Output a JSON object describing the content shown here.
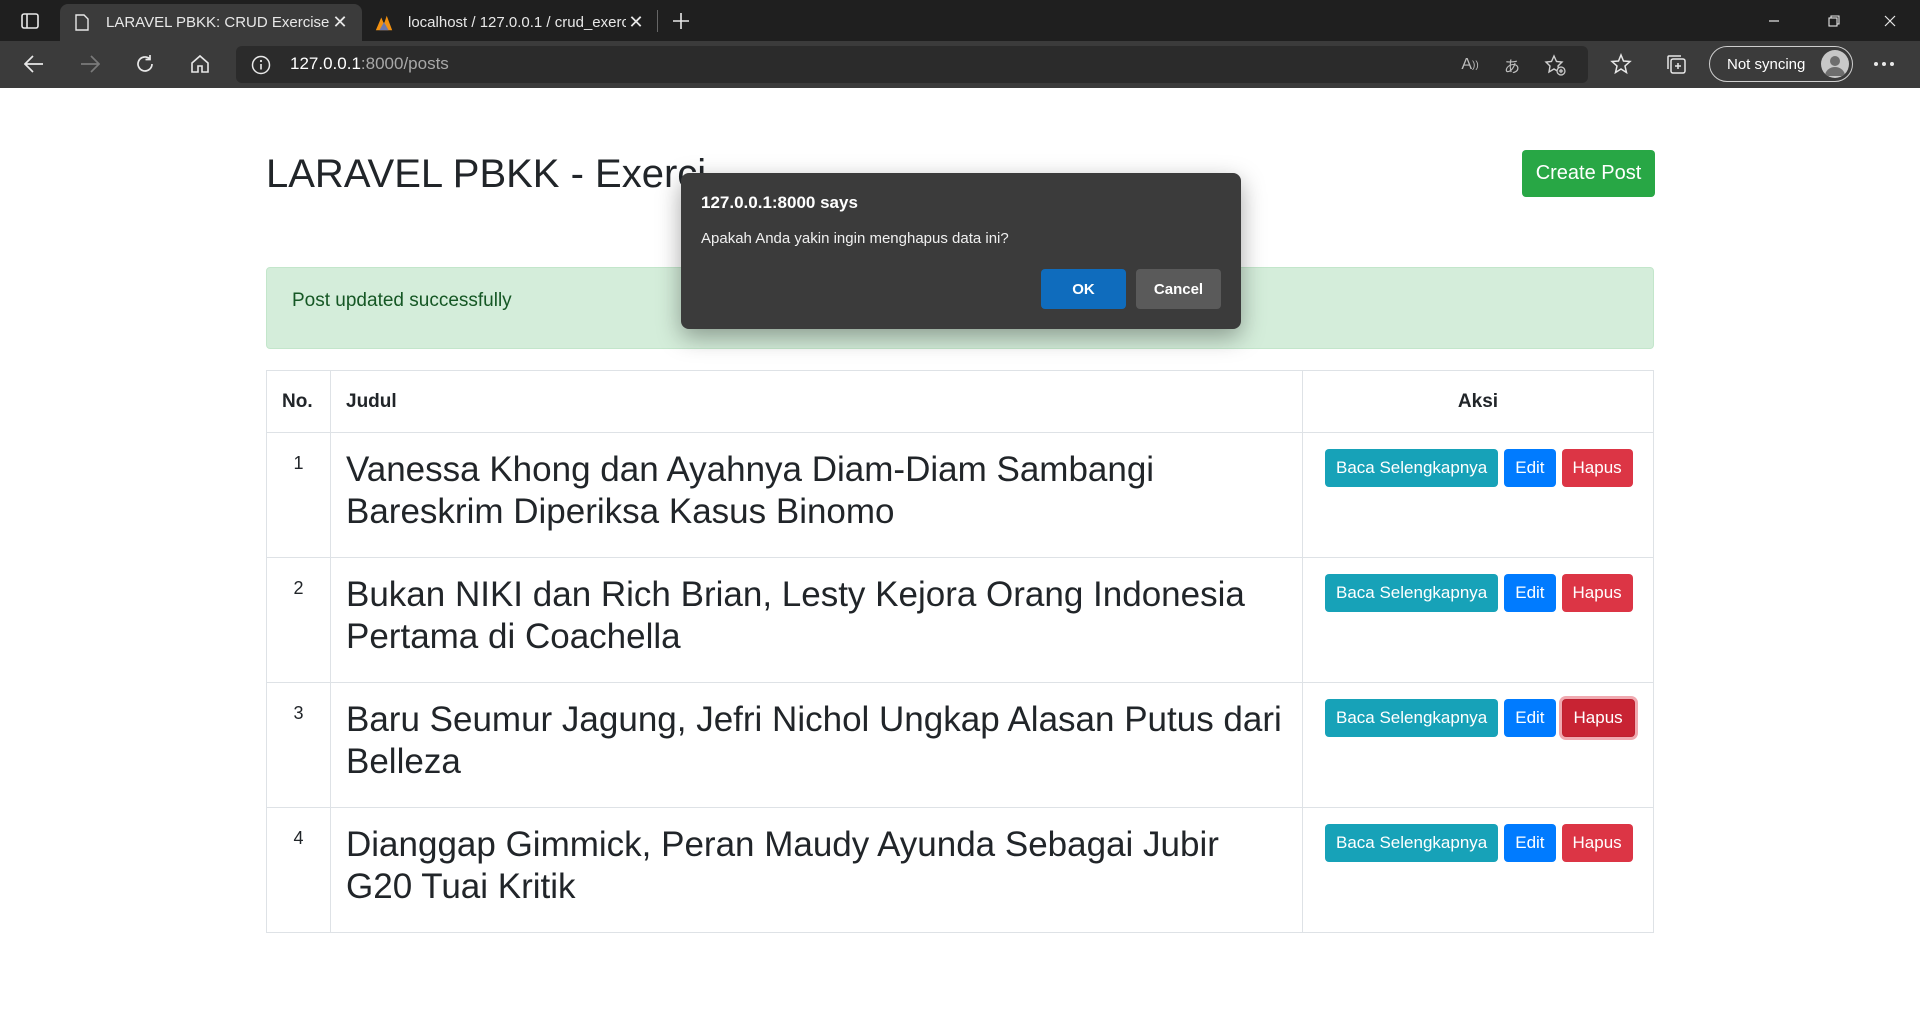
{
  "browser": {
    "tabs": [
      {
        "title": "LARAVEL PBKK: CRUD Exercise",
        "active": true
      },
      {
        "title": "localhost / 127.0.0.1 / crud_exerc",
        "active": false
      }
    ],
    "address": {
      "host": "127.0.0.1",
      "rest": ":8000/posts"
    },
    "sync_label": "Not syncing"
  },
  "page": {
    "title": "LARAVEL PBKK - Exerci",
    "create_button": "Create Post",
    "alert": "Post updated successfully",
    "table": {
      "headers": {
        "no": "No.",
        "judul": "Judul",
        "aksi": "Aksi"
      },
      "rows": [
        {
          "no": "1",
          "judul": "Vanessa Khong dan Ayahnya Diam-Diam Sambangi Bareskrim Diperiksa Kasus Binomo"
        },
        {
          "no": "2",
          "judul": "Bukan NIKI dan Rich Brian, Lesty Kejora Orang Indonesia Pertama di Coachella"
        },
        {
          "no": "3",
          "judul": "Baru Seumur Jagung, Jefri Nichol Ungkap Alasan Putus dari Belleza"
        },
        {
          "no": "4",
          "judul": "Dianggap Gimmick, Peran Maudy Ayunda Sebagai Jubir G20 Tuai Kritik"
        }
      ],
      "actions": {
        "read": "Baca Selengkapnya",
        "edit": "Edit",
        "delete": "Hapus"
      }
    }
  },
  "dialog": {
    "origin": "127.0.0.1:8000 says",
    "message": "Apakah Anda yakin ingin menghapus data ini?",
    "ok": "OK",
    "cancel": "Cancel"
  },
  "colors": {
    "success": "#28a745",
    "info": "#17a2b8",
    "primary": "#007bff",
    "danger": "#dc3545",
    "dialog_ok": "#0f6cbd"
  }
}
